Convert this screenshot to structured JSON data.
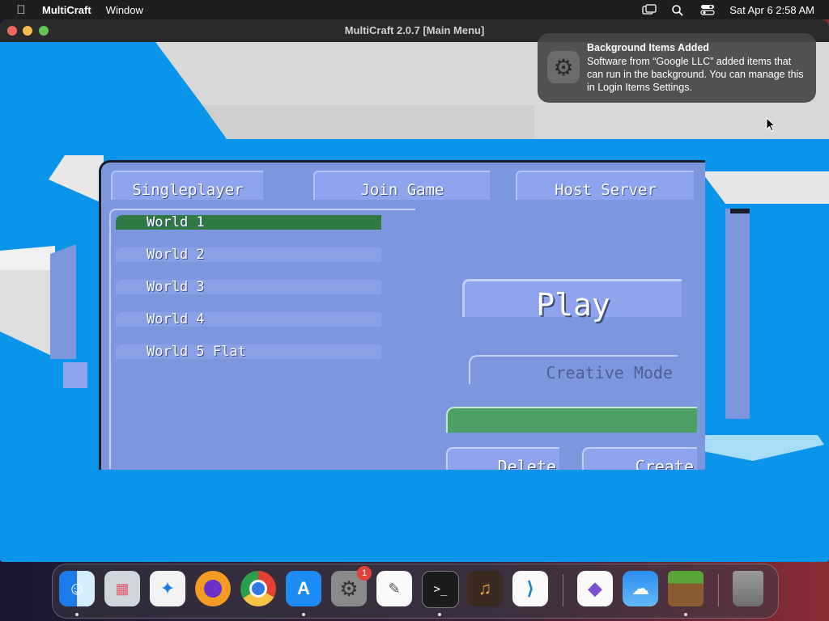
{
  "menubar": {
    "app_name": "MultiCraft",
    "menus": [
      "Window"
    ],
    "datetime": "Sat Apr 6  2:58 AM"
  },
  "window": {
    "title": "MultiCraft 2.0.7 [Main Menu]"
  },
  "notification": {
    "title": "Background Items Added",
    "body": "Software from “Google LLC” added items that can run in the background. You can manage this in Login Items Settings.",
    "icon": "gear-icon"
  },
  "game_menu": {
    "tabs": [
      "Singleplayer",
      "Join Game",
      "Host Server"
    ],
    "worlds": [
      {
        "label": "World 1",
        "selected": true
      },
      {
        "label": "World 2",
        "selected": false
      },
      {
        "label": "World 3",
        "selected": false
      },
      {
        "label": "World 4",
        "selected": false
      },
      {
        "label": "World 5 Flat",
        "selected": false
      }
    ],
    "play_label": "Play",
    "creative_label": "Creative Mode",
    "world_name_value": "",
    "delete_label": "Delete",
    "create_label": "Create"
  },
  "dock": {
    "apps": [
      {
        "name": "Finder",
        "icon": "finder-icon"
      },
      {
        "name": "Launchpad",
        "icon": "launchpad-icon"
      },
      {
        "name": "Safari",
        "icon": "safari-icon"
      },
      {
        "name": "Firefox",
        "icon": "firefox-icon"
      },
      {
        "name": "Chrome",
        "icon": "chrome-icon"
      },
      {
        "name": "App Store",
        "icon": "app-store-icon"
      },
      {
        "name": "System Settings",
        "icon": "settings-icon",
        "badge": "1"
      },
      {
        "name": "TextEdit",
        "icon": "textedit-icon"
      },
      {
        "name": "Terminal",
        "icon": "terminal-icon"
      },
      {
        "name": "GarageBand",
        "icon": "garageband-icon"
      },
      {
        "name": "VS Code",
        "icon": "vscode-icon"
      },
      {
        "name": "Visual Studio",
        "icon": "visual-studio-icon"
      },
      {
        "name": "Weather",
        "icon": "weather-icon"
      },
      {
        "name": "MultiCraft",
        "icon": "multicraft-icon"
      },
      {
        "name": "Trash",
        "icon": "trash-icon"
      }
    ]
  }
}
